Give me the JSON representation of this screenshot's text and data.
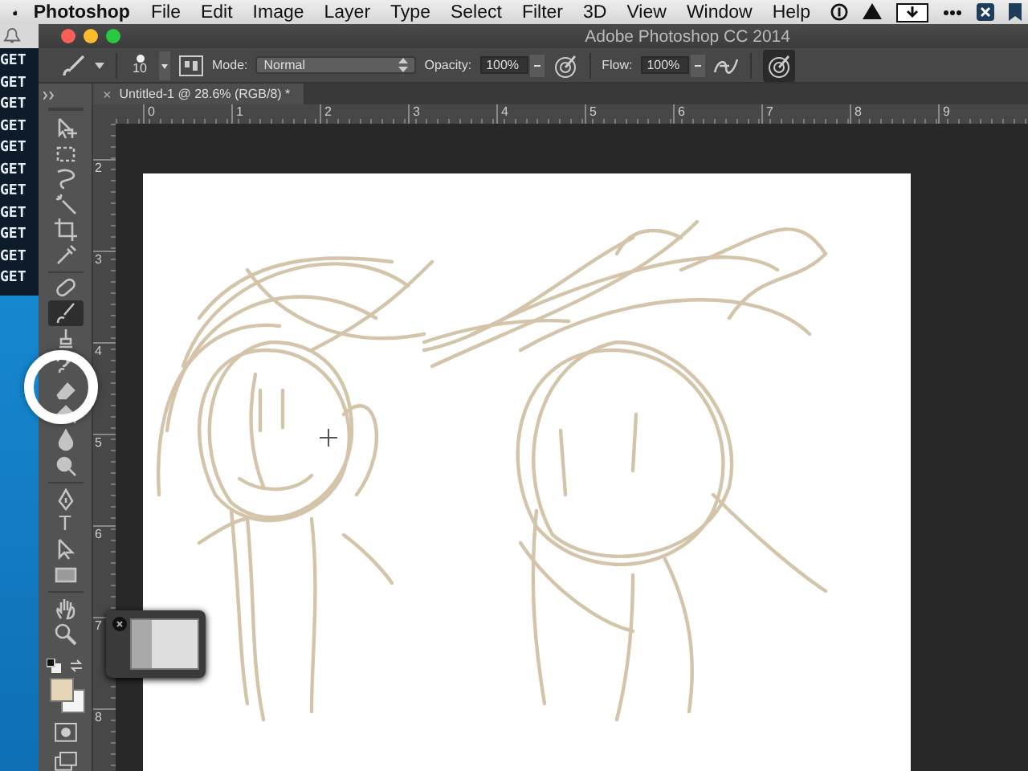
{
  "menu_bar": {
    "app_name": "Photoshop",
    "items": [
      "File",
      "Edit",
      "Image",
      "Layer",
      "Type",
      "Select",
      "Filter",
      "3D",
      "View",
      "Window",
      "Help"
    ]
  },
  "terminal": {
    "lines": [
      "GET",
      "GET",
      "GET",
      "GET",
      "GET",
      "GET",
      "GET",
      "GET",
      "GET",
      "GET",
      "GET"
    ]
  },
  "window": {
    "title": "Adobe Photoshop CC 2014"
  },
  "options_bar": {
    "brush_size": "10",
    "mode_label": "Mode:",
    "mode": "Normal",
    "opacity_label": "Opacity:",
    "opacity": "100%",
    "flow_label": "Flow:",
    "flow": "100%",
    "tablet_pressure_on": true
  },
  "document_tab": {
    "title": "Untitled-1 @ 28.6% (RGB/8) *",
    "close": "×"
  },
  "rulers": {
    "horizontal": [
      "0",
      "1",
      "2",
      "3",
      "4",
      "5",
      "6",
      "7",
      "8",
      "9"
    ],
    "vertical": [
      "2",
      "3",
      "4",
      "5",
      "6",
      "7",
      "8"
    ]
  },
  "tool_groups": [
    {
      "tools": [
        {
          "kind": "move",
          "selected": false
        },
        {
          "kind": "marquee",
          "selected": false
        },
        {
          "kind": "lasso",
          "selected": false
        },
        {
          "kind": "magic-wand",
          "selected": false
        },
        {
          "kind": "crop",
          "selected": false
        },
        {
          "kind": "eyedropper",
          "selected": false
        }
      ]
    },
    {
      "tools": [
        {
          "kind": "bandage",
          "selected": false
        },
        {
          "kind": "brush",
          "selected": true
        },
        {
          "kind": "stamp",
          "selected": false
        },
        {
          "kind": "history-brush",
          "selected": false
        },
        {
          "kind": "eraser",
          "selected": false
        },
        {
          "kind": "bucket",
          "selected": false
        },
        {
          "kind": "drop",
          "selected": false
        },
        {
          "kind": "dodge",
          "selected": false
        }
      ]
    },
    {
      "tools": [
        {
          "kind": "pen",
          "selected": false
        },
        {
          "kind": "type",
          "label": "T",
          "selected": false
        },
        {
          "kind": "arrow",
          "selected": false
        },
        {
          "kind": "rectangle",
          "selected": false
        }
      ]
    },
    {
      "tools": [
        {
          "kind": "hand",
          "selected": false
        },
        {
          "kind": "zoom",
          "selected": false
        }
      ]
    }
  ]
}
